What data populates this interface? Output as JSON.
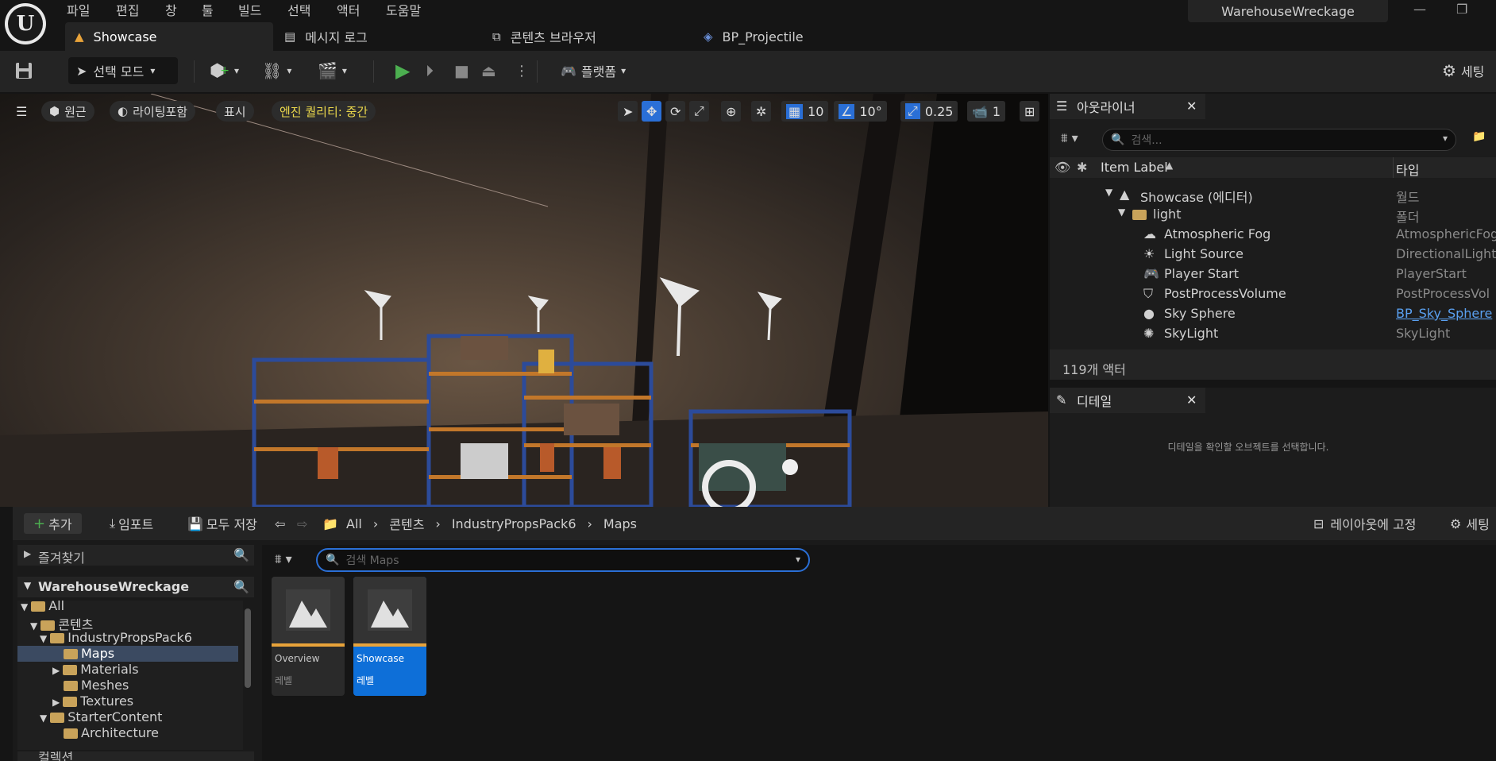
{
  "menu": [
    "파일",
    "편집",
    "창",
    "툴",
    "빌드",
    "선택",
    "액터",
    "도움말"
  ],
  "project_title": "WarehouseWreckage",
  "tabs": [
    {
      "label": "Showcase",
      "icon": "level-icon"
    },
    {
      "label": "메시지 로그",
      "icon": "log-icon"
    },
    {
      "label": "콘텐츠 브라우저",
      "icon": "content-browser-icon"
    },
    {
      "label": "BP_Projectile",
      "icon": "blueprint-icon"
    }
  ],
  "toolbar": {
    "select_mode": "선택 모드",
    "platform": "플랫폼",
    "settings": "세팅"
  },
  "viewport": {
    "perspective": "원근",
    "lighting": "라이팅포함",
    "show": "표시",
    "quality": "엔진 퀄리티: 중간",
    "grid_snap": "10",
    "rotation_snap": "10°",
    "scale_snap": "0.25",
    "camera_speed": "1"
  },
  "outliner": {
    "title": "아웃라이너",
    "search_placeholder": "검색...",
    "col_label": "Item Label",
    "col_type": "타입",
    "rows": [
      {
        "label": "Showcase (에디터)",
        "type": "월드",
        "icon": "world-icon"
      },
      {
        "label": "light",
        "type": "폴더",
        "icon": "folder-icon"
      },
      {
        "label": "Atmospheric Fog",
        "type": "AtmosphericFog",
        "icon": "fog-icon"
      },
      {
        "label": "Light Source",
        "type": "DirectionalLight",
        "icon": "sun-icon"
      },
      {
        "label": "Player Start",
        "type": "PlayerStart",
        "icon": "gamepad-icon"
      },
      {
        "label": "PostProcessVolume",
        "type": "PostProcessVol",
        "icon": "volume-icon"
      },
      {
        "label": "Sky Sphere",
        "type": "BP_Sky_Sphere",
        "icon": "sphere-icon"
      },
      {
        "label": "SkyLight",
        "type": "SkyLight",
        "icon": "skylight-icon"
      }
    ],
    "actor_count": "119개 액터"
  },
  "details": {
    "title": "디테일",
    "empty_msg": "디테일을 확인할 오브젝트를 선택합니다."
  },
  "content_browser": {
    "add": "추가",
    "import": "임포트",
    "save_all": "모두 저장",
    "breadcrumb": [
      "All",
      "콘텐츠",
      "IndustryPropsPack6",
      "Maps"
    ],
    "lock_layout": "레이아웃에 고정",
    "settings": "세팅",
    "favorites": "즐겨찾기",
    "project": "WarehouseWreckage",
    "search_placeholder": "검색 Maps",
    "tree": [
      {
        "label": "All",
        "depth": 0
      },
      {
        "label": "콘텐츠",
        "depth": 1
      },
      {
        "label": "IndustryPropsPack6",
        "depth": 2
      },
      {
        "label": "Maps",
        "depth": 3
      },
      {
        "label": "Materials",
        "depth": 3
      },
      {
        "label": "Meshes",
        "depth": 3
      },
      {
        "label": "Textures",
        "depth": 3
      },
      {
        "label": "StarterContent",
        "depth": 2
      },
      {
        "label": "Architecture",
        "depth": 3
      }
    ],
    "collections": "컬렉션",
    "assets": [
      {
        "name": "Overview",
        "kind": "레벨"
      },
      {
        "name": "Showcase",
        "kind": "레벨"
      }
    ]
  }
}
